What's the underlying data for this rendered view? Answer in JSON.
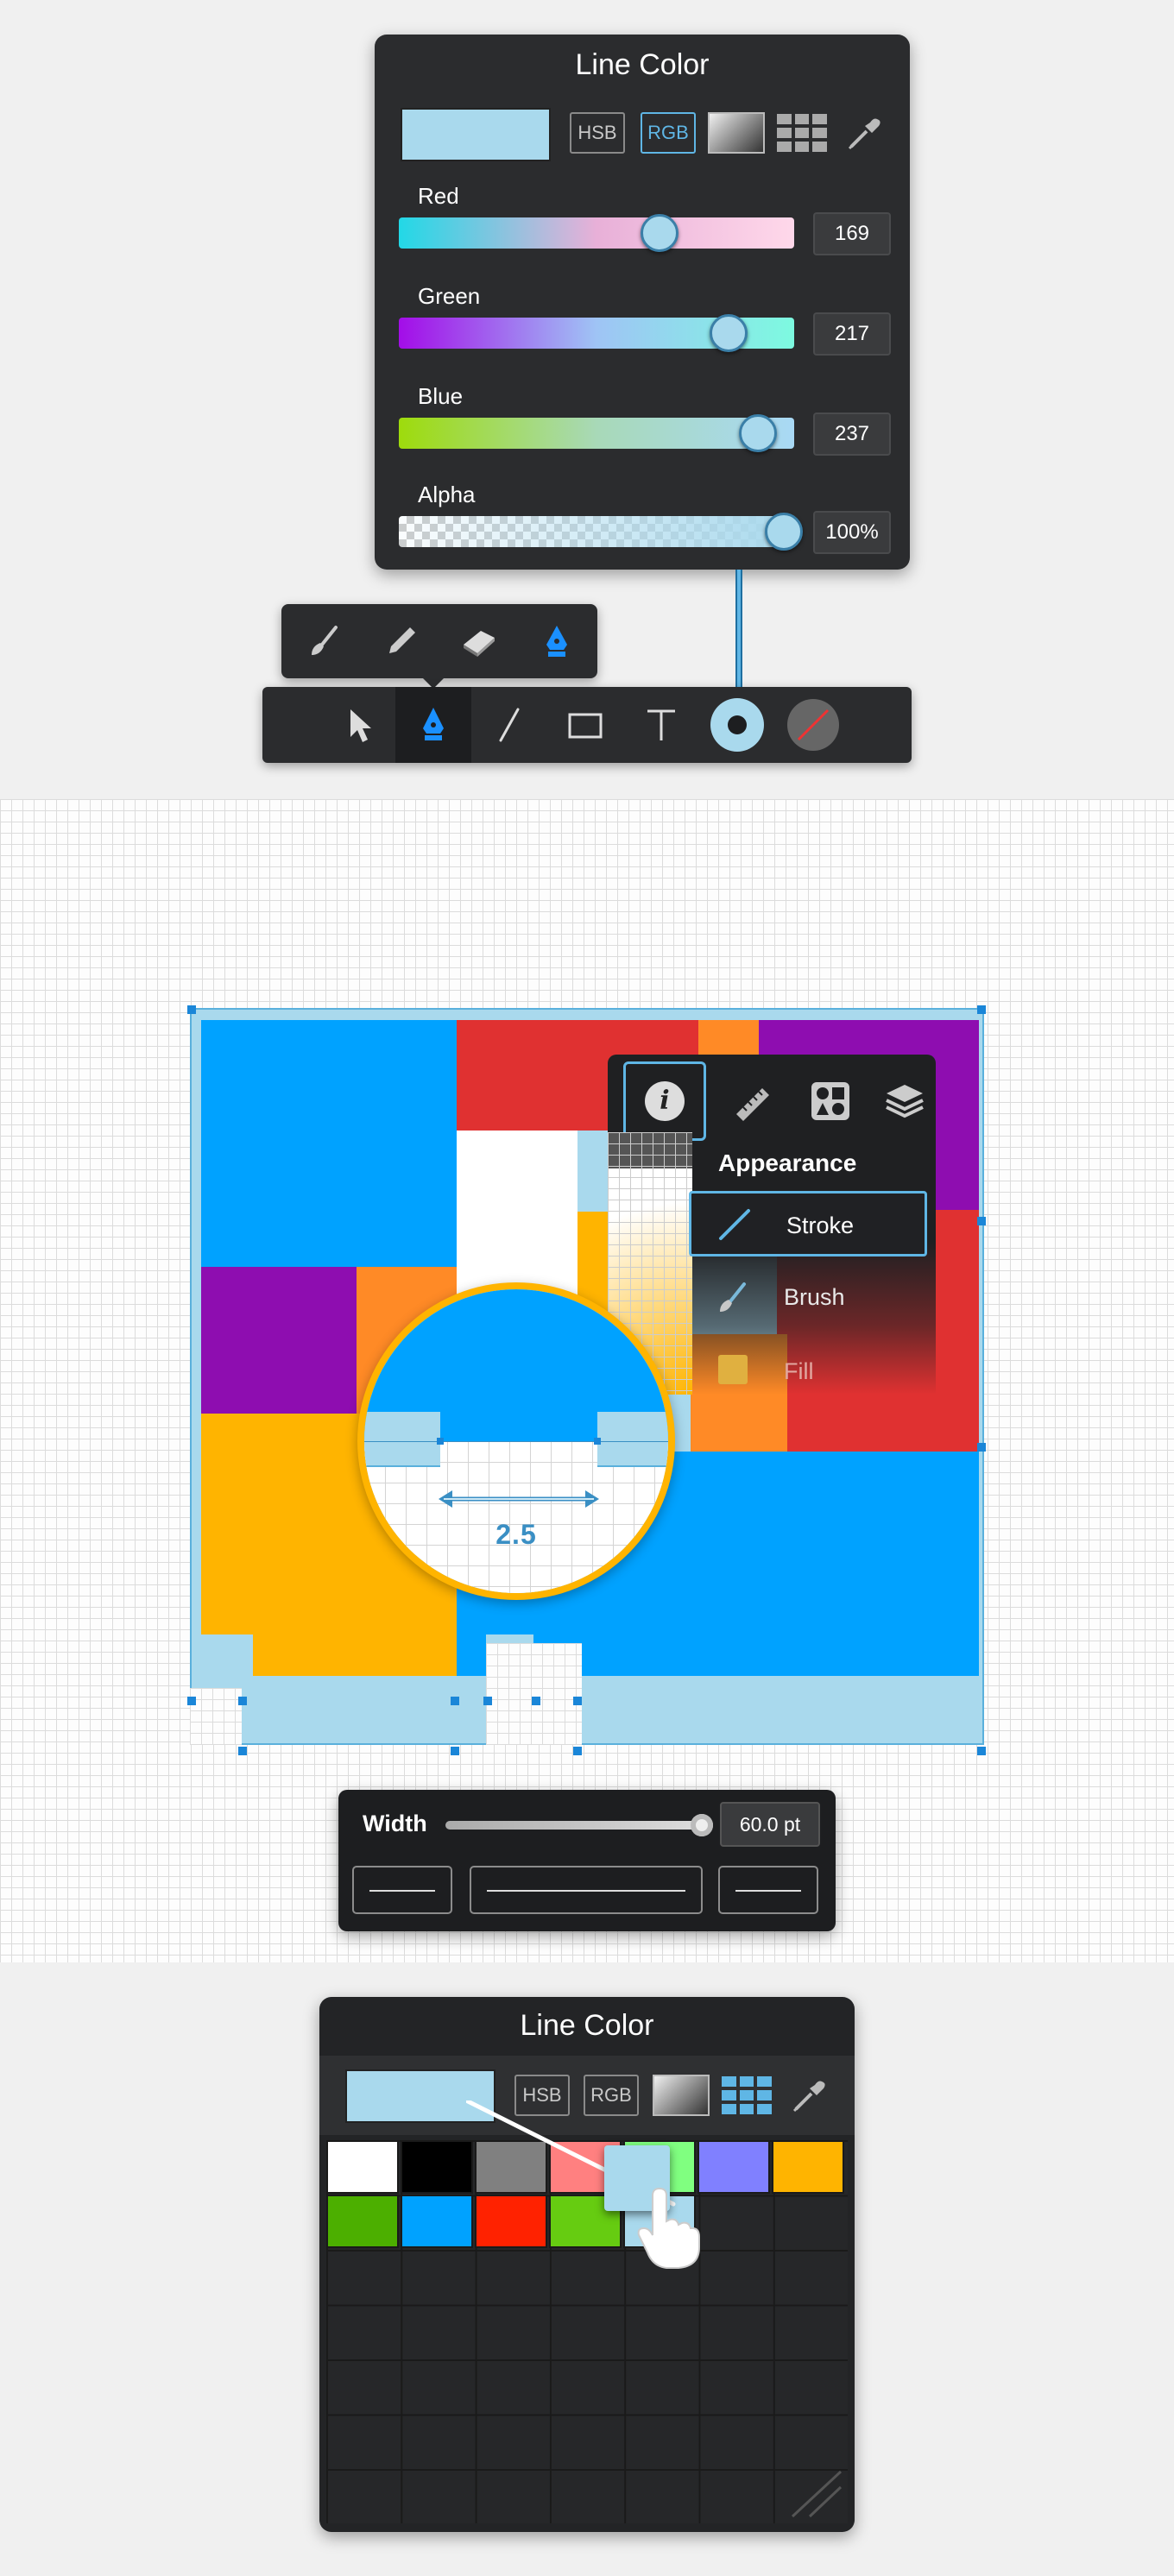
{
  "top_picker": {
    "title": "Line Color",
    "swatch_color": "#a9d9ed",
    "hsb_label": "HSB",
    "rgb_label": "RGB",
    "sliders": [
      {
        "label": "Red",
        "value": "169",
        "level": 0.663
      },
      {
        "label": "Green",
        "value": "217",
        "level": 0.851
      },
      {
        "label": "Blue",
        "value": "237",
        "level": 0.929
      },
      {
        "label": "Alpha",
        "value": "100%",
        "level": 1.0
      }
    ]
  },
  "brush_popup": {
    "icons": [
      "paintbrush-icon",
      "pencil-icon",
      "eraser-icon",
      "pen-nib-icon"
    ],
    "selected": "pen-nib-icon"
  },
  "toolbar": {
    "tools": [
      "select-arrow-icon",
      "pen-nib-icon",
      "line-icon",
      "rectangle-icon",
      "text-icon",
      "stroke-color-icon",
      "no-fill-icon"
    ],
    "selected": "pen-nib-icon"
  },
  "inspector": {
    "tabs": [
      "info-icon",
      "ruler-icon",
      "shapes-icon",
      "layers-icon"
    ],
    "section_title": "Appearance",
    "items": [
      {
        "label": "Stroke",
        "icon": "stroke-line-icon",
        "selected": true
      },
      {
        "label": "Brush",
        "icon": "brush-icon",
        "selected": false
      },
      {
        "label": "Fill",
        "icon": "fill-square-icon",
        "selected": false
      }
    ]
  },
  "magnifier": {
    "measurement": "2.5"
  },
  "width_panel": {
    "label": "Width",
    "value": "60.0 pt",
    "level": 1.0
  },
  "bottom_picker": {
    "title": "Line Color",
    "swatch_color": "#a9d9ed",
    "hsb_label": "HSB",
    "rgb_label": "RGB",
    "palette_row1": [
      "#ffffff",
      "#000000",
      "#808080",
      "#ff8080",
      "#80ff80",
      "#8080ff",
      "#ffb400"
    ],
    "palette_row2": [
      "#4caf00",
      "#00a2ff",
      "#ff2200",
      "#66cc11",
      "#a9d9ed"
    ]
  },
  "colors": {
    "accent": "#5fb6e5",
    "panel": "#2b2c2e",
    "blue": "#00a2ff",
    "red": "#e03131",
    "purple": "#8e0db0",
    "orange": "#ff8a26",
    "yellow": "#ffb400"
  }
}
